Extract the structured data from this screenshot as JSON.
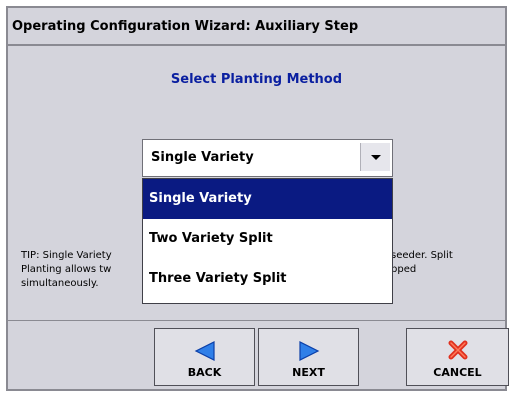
{
  "window": {
    "title": "Operating Configuration Wizard:  Auxiliary Step"
  },
  "main": {
    "heading": "Select Planting Method",
    "combo": {
      "selected_value": "Single Variety"
    },
    "dropdown": {
      "options": [
        {
          "label": "Single Variety",
          "selected": true
        },
        {
          "label": "Two Variety Split",
          "selected": false
        },
        {
          "label": "Three Variety Split",
          "selected": false
        }
      ]
    },
    "tip": {
      "line1": "TIP: Single Variety",
      "line1_tail": "seeder.  Split",
      "line2": "Planting allows tw",
      "line2_tail": "pped",
      "line3": "simultaneously."
    }
  },
  "buttons": {
    "back_label": "BACK",
    "next_label": "NEXT",
    "cancel_label": "CANCEL"
  },
  "colors": {
    "heading": "#0a1fa0",
    "selection": "#0a1a82",
    "arrow_fill": "#2f7fe8",
    "cancel_icon": "#e0301e"
  }
}
